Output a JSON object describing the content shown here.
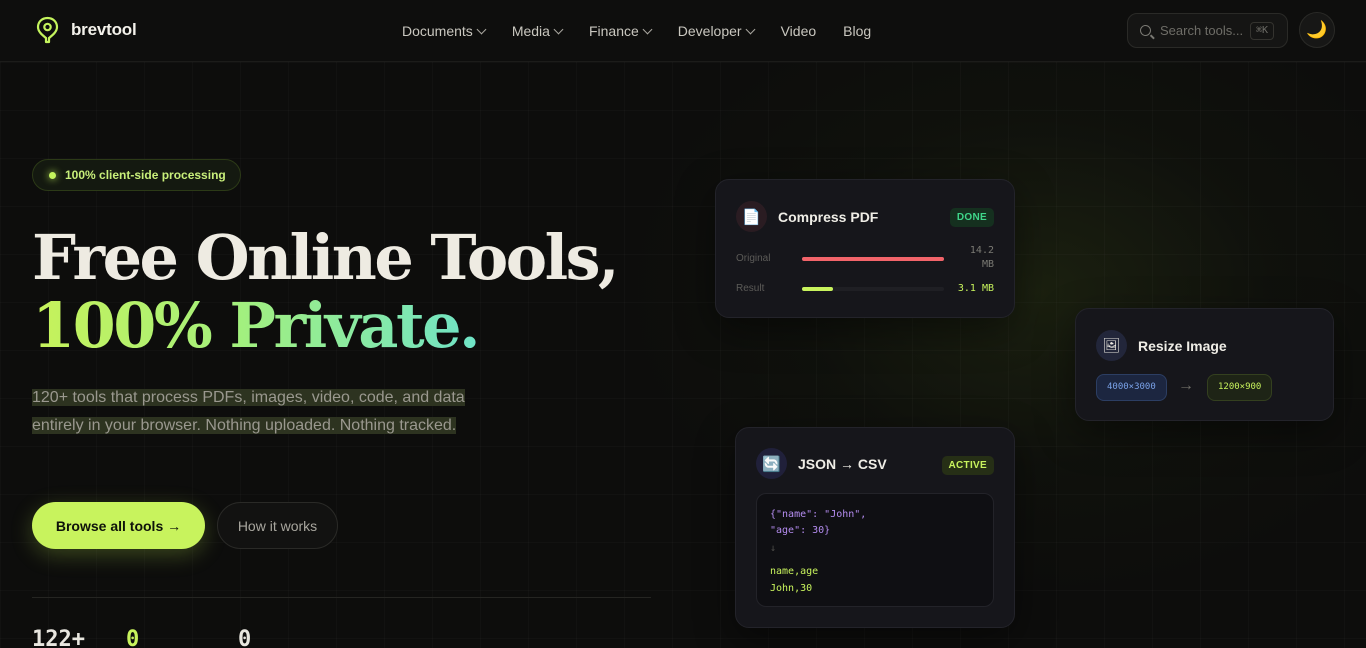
{
  "colors": {
    "accent": "#c8f35d",
    "background": "#0d0d0c",
    "card": "#16161b",
    "done_badge": "#3fd68a",
    "bar_original": "#f2646a",
    "bar_result": "#c8f35d"
  },
  "nav": {
    "logo_icon": "location-pin-icon",
    "brand": "brevtool",
    "links": [
      {
        "label": "Documents",
        "dropdown": true
      },
      {
        "label": "Media",
        "dropdown": true
      },
      {
        "label": "Finance",
        "dropdown": true
      },
      {
        "label": "Developer",
        "dropdown": true
      },
      {
        "label": "Video",
        "dropdown": false
      },
      {
        "label": "Blog",
        "dropdown": false
      }
    ],
    "search_placeholder": "Search tools...",
    "search_shortcut": "⌘K",
    "theme_icon": "🌙"
  },
  "hero": {
    "pill_text": "100% client-side processing",
    "title_line1": "Free Online Tools,",
    "title_line2": "100% Private.",
    "subtitle": "120+ tools that process PDFs, images, video, code, and data entirely in your browser. Nothing uploaded. Nothing tracked.",
    "primary_button": "Browse all tools →",
    "secondary_button": "How it works",
    "stats": [
      "122+",
      "0",
      "0"
    ]
  },
  "cards": {
    "compress": {
      "icon": "📄",
      "title": "Compress PDF",
      "badge": "DONE",
      "original_label": "Original",
      "original_value": "14.2 MB",
      "original_fill": 1.0,
      "result_label": "Result",
      "result_value": "3.1 MB",
      "result_fill": 0.22
    },
    "resize": {
      "icon": "🖼",
      "title": "Resize Image",
      "from": "4000×3000",
      "arrow": "→",
      "to": "1200×900"
    },
    "json": {
      "icon": "🔄",
      "title": "JSON → CSV",
      "badge": "ACTIVE",
      "code_line1": "{\"name\": \"John\",",
      "code_line2": "\"age\": 30}",
      "code_arrow": "↓",
      "csv_line1": "name,age",
      "csv_line2": "John,30"
    }
  }
}
